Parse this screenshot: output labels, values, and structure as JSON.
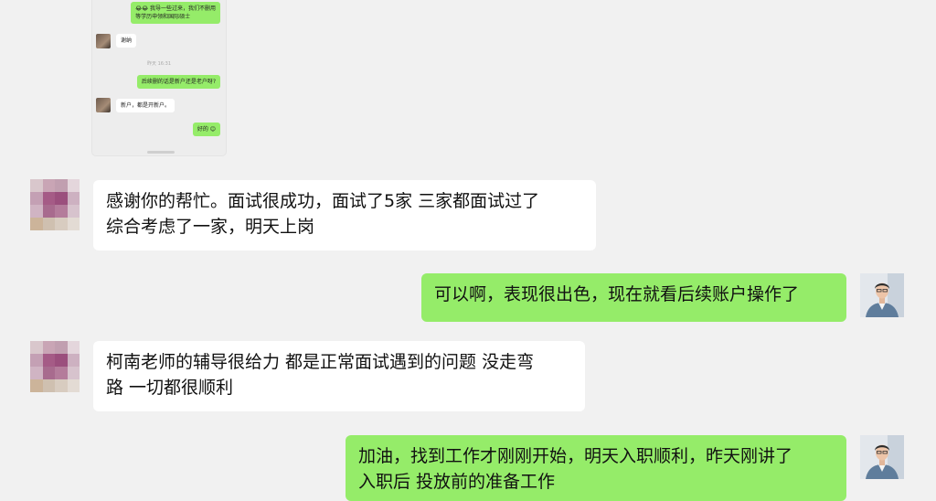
{
  "embedded_screenshot": {
    "messages": [
      {
        "side": "right",
        "lines": [
          "😂😂 我导一些过来，我们不删用",
          "等学历申领和国际硕士"
        ]
      },
      {
        "side": "left",
        "lines": [
          "谢纳"
        ]
      },
      {
        "side": "time",
        "lines": [
          "昨天 16:31"
        ]
      },
      {
        "side": "right",
        "lines": [
          "后续删的话是新户还是老户呀?"
        ]
      },
      {
        "side": "left",
        "lines": [
          "新户，都是开新户。"
        ]
      },
      {
        "side": "right",
        "lines": [
          "好的 😊"
        ]
      }
    ]
  },
  "messages": [
    {
      "side": "left",
      "lines": [
        "感谢你的帮忙。面试很成功，面试了5家  三家都面试过了",
        "综合考虑了一家，明天上岗"
      ]
    },
    {
      "side": "right",
      "lines": [
        "可以啊，表现很出色，现在就看后续账户操作了"
      ]
    },
    {
      "side": "left",
      "lines": [
        "柯南老师的辅导很给力 都是正常面试遇到的问题 没走弯",
        "路 一切都很顺利"
      ]
    },
    {
      "side": "right",
      "lines": [
        "加油，找到工作才刚刚开始，明天入职顺利，昨天刚讲了",
        "入职后 投放前的准备工作"
      ]
    }
  ],
  "colors": {
    "sent_bubble": "#95ec69",
    "received_bubble": "#ffffff",
    "background": "#f1f1f1"
  }
}
